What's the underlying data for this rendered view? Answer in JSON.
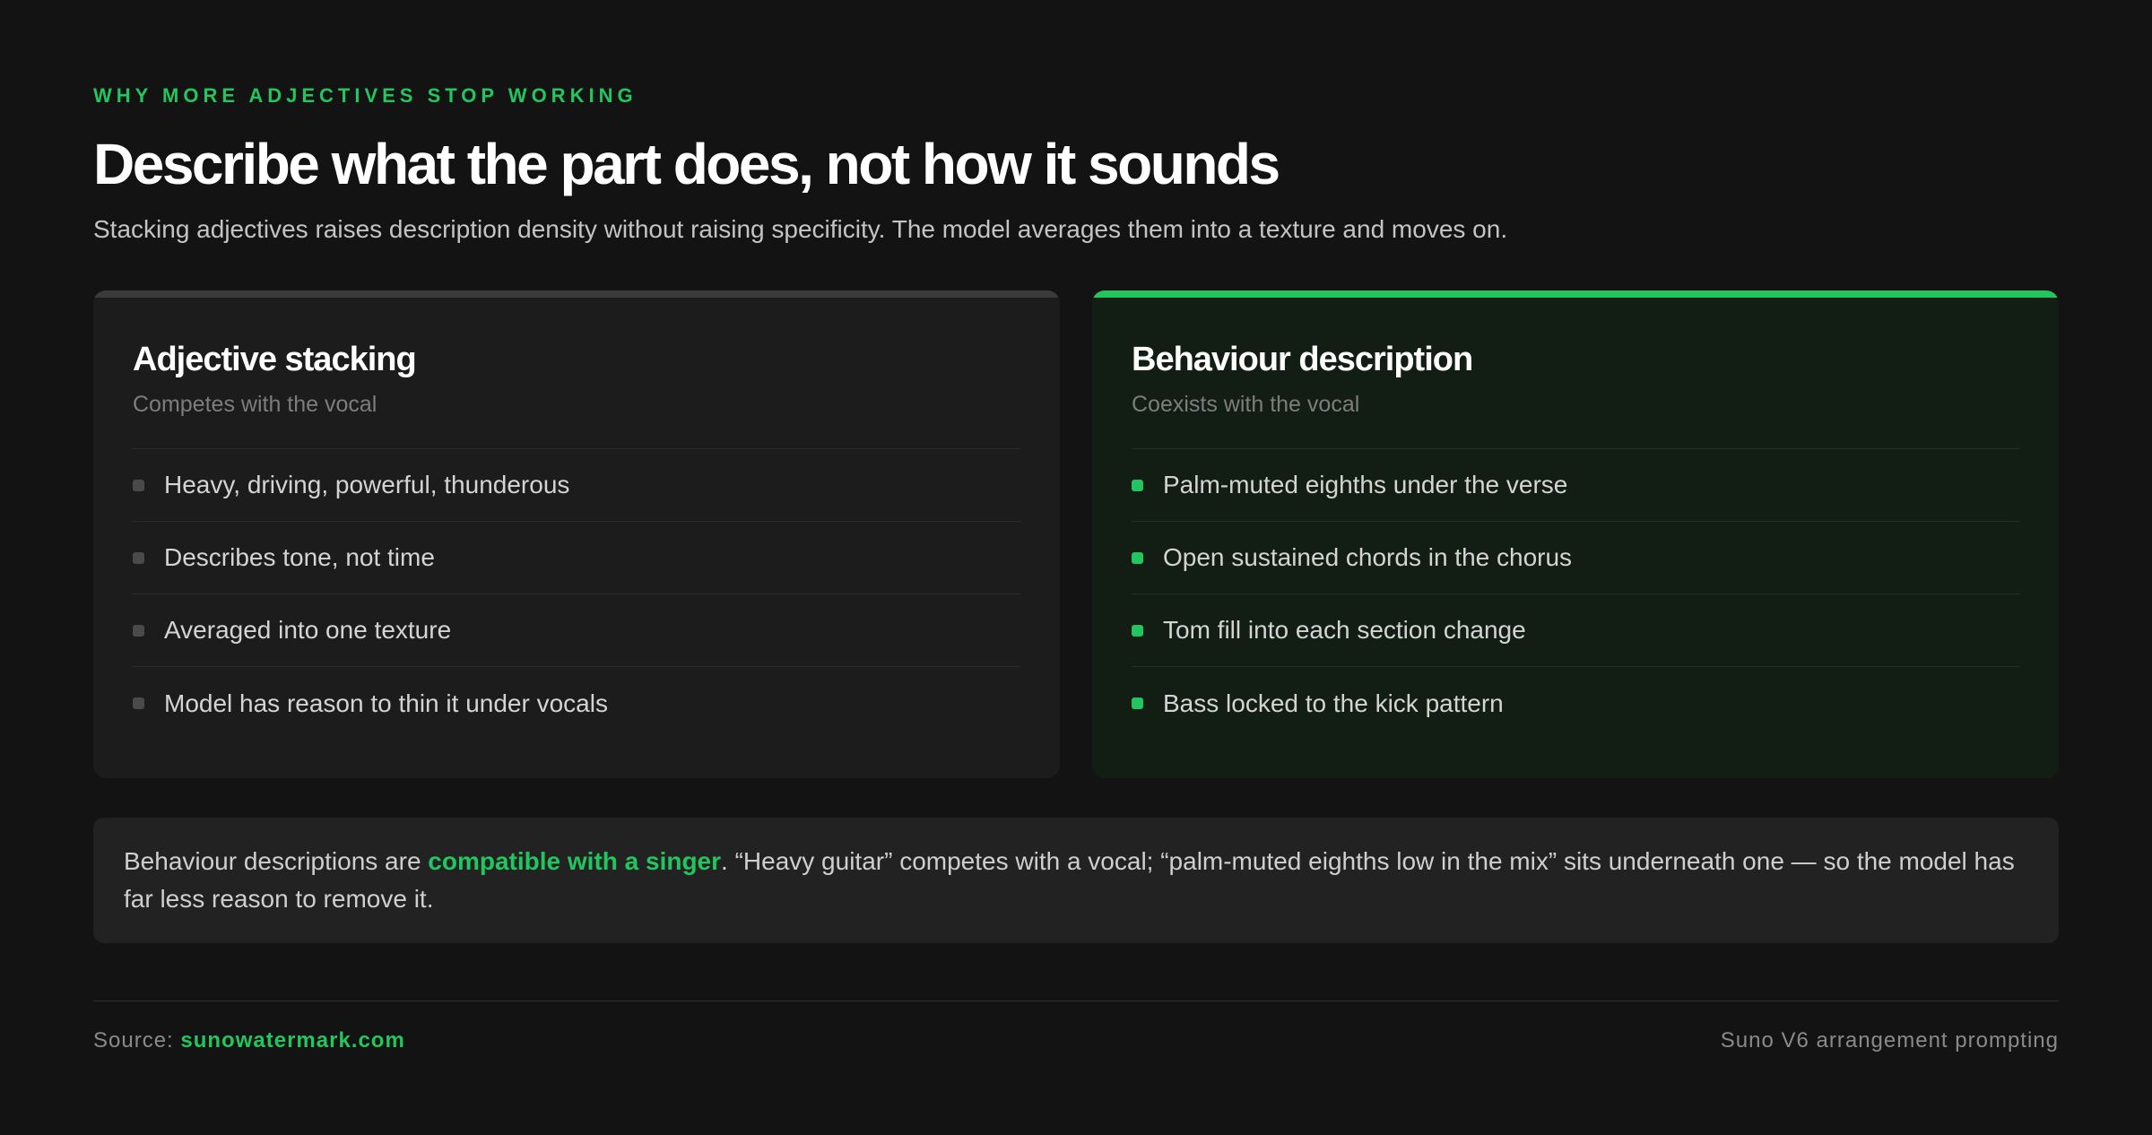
{
  "header": {
    "eyebrow": "WHY MORE ADJECTIVES STOP WORKING",
    "title": "Describe what the part does, not how it sounds",
    "subtitle": "Stacking adjectives raises description density without raising specificity. The model averages them into a texture and moves on."
  },
  "cards": {
    "left": {
      "title": "Adjective stacking",
      "subtitle": "Competes with the vocal",
      "items": [
        "Heavy, driving, powerful, thunderous",
        "Describes tone, not time",
        "Averaged into one texture",
        "Model has reason to thin it under vocals"
      ]
    },
    "right": {
      "title": "Behaviour description",
      "subtitle": "Coexists with the vocal",
      "items": [
        "Palm-muted eighths under the verse",
        "Open sustained chords in the chorus",
        "Tom fill into each section change",
        "Bass locked to the kick pattern"
      ]
    }
  },
  "note": {
    "prefix": "Behaviour descriptions are ",
    "highlight": "compatible with a singer",
    "suffix": ". “Heavy guitar” competes with a vocal; “palm-muted eighths low in the mix” sits underneath one — so the model has far less reason to remove it."
  },
  "footer": {
    "source_label": "Source: ",
    "source_link": "sunowatermark.com",
    "right_text": "Suno V6 arrangement prompting"
  },
  "colors": {
    "accent": "#22c55e",
    "background": "#131313"
  }
}
